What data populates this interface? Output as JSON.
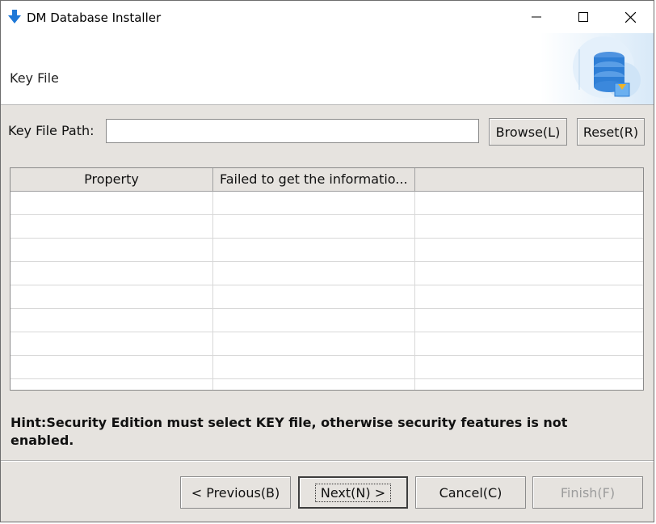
{
  "window": {
    "title": "DM Database Installer",
    "app_icon": "download-arrow-icon",
    "controls": [
      "minimize-icon",
      "maximize-icon",
      "close-icon"
    ]
  },
  "header": {
    "title": "Key File",
    "art_icon": "database-icon"
  },
  "key_path": {
    "label": "Key File Path:",
    "value": "",
    "browse_label": "Browse(L)",
    "reset_label": "Reset(R)"
  },
  "table": {
    "columns": [
      "Property",
      "Failed to get the informatio...",
      ""
    ],
    "rows": [
      [
        "",
        "",
        ""
      ],
      [
        "",
        "",
        ""
      ],
      [
        "",
        "",
        ""
      ],
      [
        "",
        "",
        ""
      ],
      [
        "",
        "",
        ""
      ],
      [
        "",
        "",
        ""
      ],
      [
        "",
        "",
        ""
      ],
      [
        "",
        "",
        ""
      ],
      [
        "",
        "",
        ""
      ]
    ]
  },
  "hint": "Hint:Security Edition must select KEY file, otherwise security features is not enabled.",
  "buttons": {
    "previous": "< Previous(B)",
    "next": "Next(N) >",
    "cancel": "Cancel(C)",
    "finish": "Finish(F)"
  },
  "colors": {
    "dialog_bg": "#e6e3df",
    "accent_blue": "#1e78d7"
  }
}
